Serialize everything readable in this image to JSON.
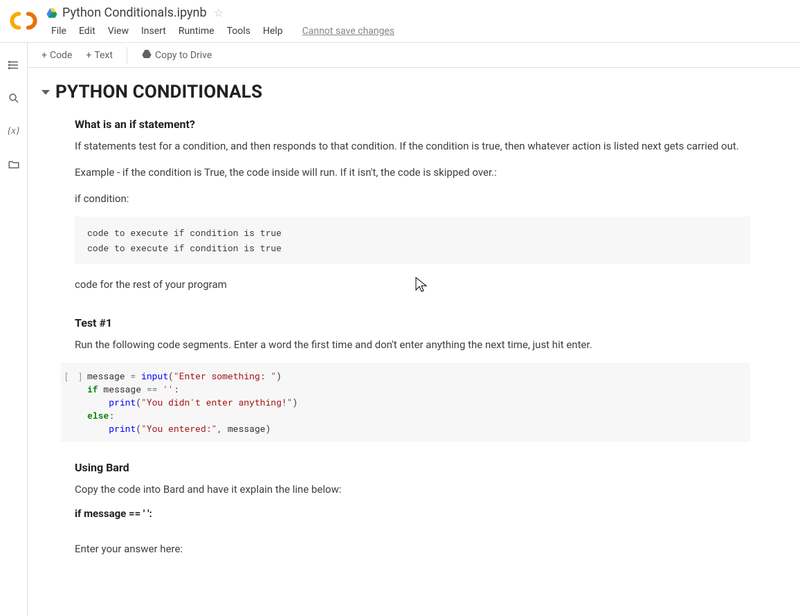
{
  "header": {
    "title": "Python Conditionals.ipynb",
    "menus": [
      "File",
      "Edit",
      "View",
      "Insert",
      "Runtime",
      "Tools",
      "Help"
    ],
    "cannot_save": "Cannot save changes"
  },
  "toolbar": {
    "code": "Code",
    "text": "Text",
    "copy_drive": "Copy to Drive"
  },
  "rail_icons": [
    "toc-icon",
    "search-icon",
    "variables-icon",
    "folder-icon"
  ],
  "section": {
    "title": "PYTHON CONDITIONALS",
    "blocks": [
      {
        "type": "h3",
        "text": "What is an if statement?"
      },
      {
        "type": "p",
        "text": "If statements test for a condition, and then responds to that condition. If the condition is true, then whatever action is listed next gets carried out."
      },
      {
        "type": "p",
        "text": "Example - if the condition is True, the code inside will run. If it isn't, the code is skipped over.:"
      },
      {
        "type": "p",
        "text": "if condition:"
      },
      {
        "type": "pre",
        "lines": [
          "code to execute if condition is true",
          "code to execute if condition is true"
        ]
      },
      {
        "type": "p",
        "text": "code for the rest of your program"
      },
      {
        "type": "spacer"
      },
      {
        "type": "h3",
        "text": "Test #1"
      },
      {
        "type": "p",
        "text": "Run the following code segments. Enter a word the first time and don't enter anything the next time, just hit enter."
      },
      {
        "type": "code",
        "gutter": "[ ]",
        "tokens": [
          [
            {
              "t": "message ",
              "c": ""
            },
            {
              "t": "= ",
              "c": "op"
            },
            {
              "t": "input",
              "c": "fn"
            },
            {
              "t": "(",
              "c": ""
            },
            {
              "t": "\"Enter something: \"",
              "c": "str"
            },
            {
              "t": ")",
              "c": ""
            }
          ],
          [
            {
              "t": "if",
              "c": "kw"
            },
            {
              "t": " message ",
              "c": ""
            },
            {
              "t": "==",
              "c": "op"
            },
            {
              "t": " ",
              "c": ""
            },
            {
              "t": "''",
              "c": "str"
            },
            {
              "t": ":",
              "c": ""
            }
          ],
          [
            {
              "t": "    ",
              "c": ""
            },
            {
              "t": "print",
              "c": "fn"
            },
            {
              "t": "(",
              "c": ""
            },
            {
              "t": "\"You didn't enter anything!\"",
              "c": "str"
            },
            {
              "t": ")",
              "c": ""
            }
          ],
          [
            {
              "t": "else",
              "c": "kw"
            },
            {
              "t": ":",
              "c": ""
            }
          ],
          [
            {
              "t": "    ",
              "c": ""
            },
            {
              "t": "print",
              "c": "fn"
            },
            {
              "t": "(",
              "c": ""
            },
            {
              "t": "\"You entered:\"",
              "c": "str"
            },
            {
              "t": ", message",
              "c": ""
            },
            {
              "t": ")",
              "c": ""
            }
          ]
        ]
      },
      {
        "type": "h3",
        "text": "Using Bard"
      },
      {
        "type": "p",
        "text": "Copy the code into Bard and have it explain the line below:"
      },
      {
        "type": "h3b",
        "text": "if message == ' ':"
      },
      {
        "type": "spacer"
      },
      {
        "type": "p",
        "text": "Enter your answer here:"
      }
    ]
  }
}
